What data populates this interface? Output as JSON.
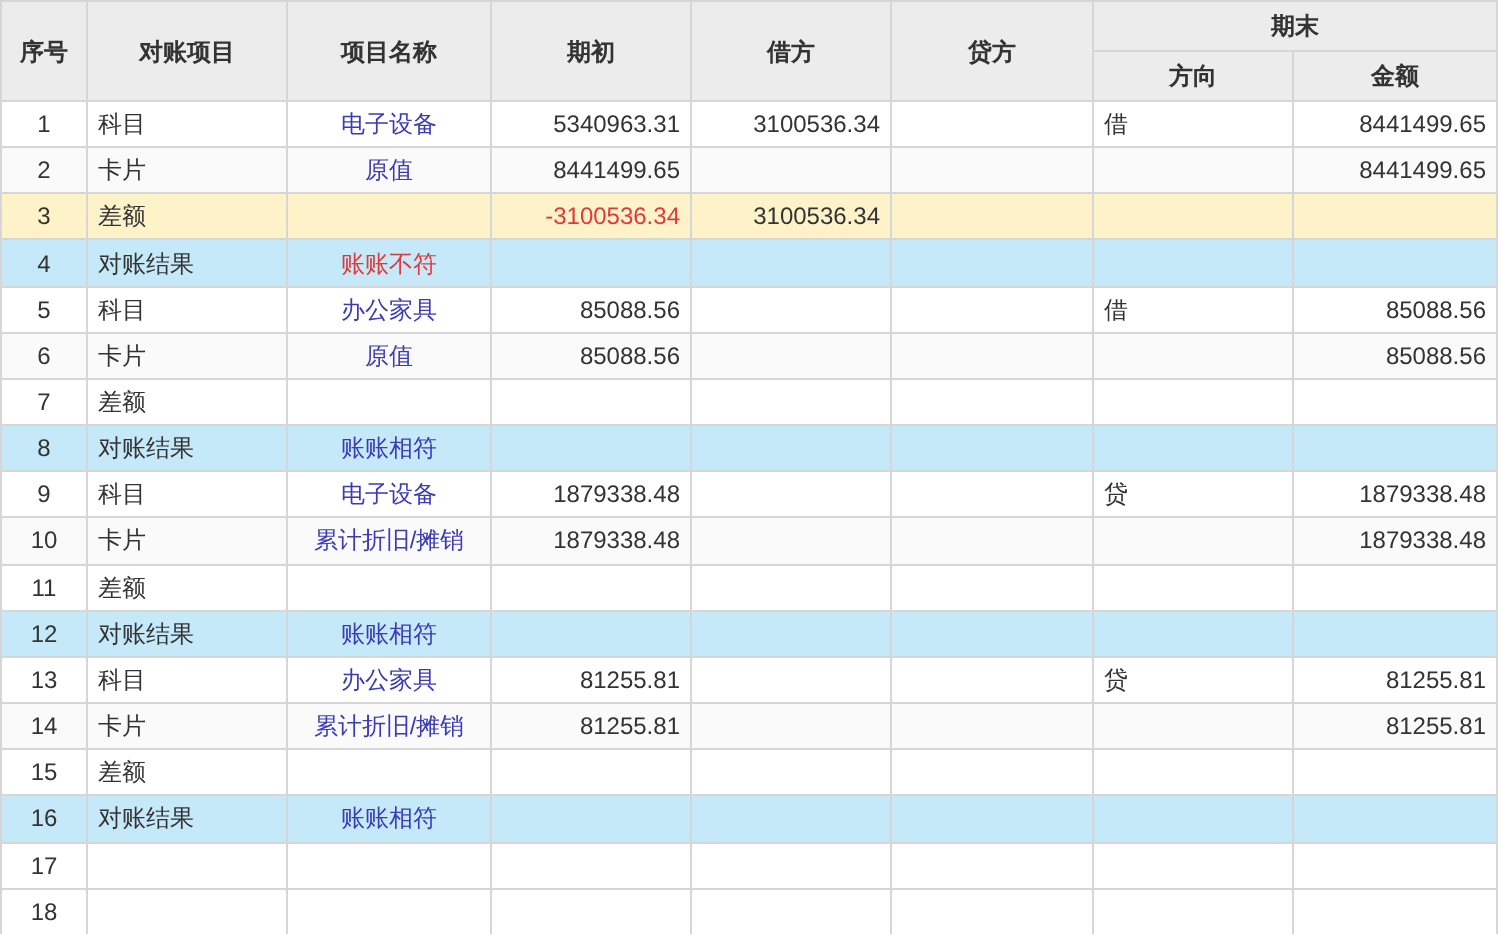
{
  "table": {
    "columns": [
      {
        "label": "序号"
      },
      {
        "label": "对账项目"
      },
      {
        "label": "项目名称"
      },
      {
        "label": "期初"
      },
      {
        "label": "借方"
      },
      {
        "label": "贷方"
      },
      {
        "label": "期末",
        "children": [
          {
            "label": "方向"
          },
          {
            "label": "金额"
          }
        ]
      }
    ],
    "rows": [
      {
        "no": "1",
        "kind": "subject",
        "item": "科目",
        "name": "电子设备",
        "opening": "5340963.31",
        "debit": "3100536.34",
        "direction": "借",
        "amount": "8441499.65"
      },
      {
        "no": "2",
        "kind": "card",
        "item": "卡片",
        "name": "原值",
        "opening": "8441499.65",
        "amount": "8441499.65"
      },
      {
        "no": "3",
        "kind": "diff",
        "flagged": true,
        "item": "差额",
        "opening": "-3100536.34",
        "debit": "3100536.34"
      },
      {
        "no": "4",
        "kind": "result",
        "flagged": true,
        "item": "对账结果",
        "name": "账账不符"
      },
      {
        "no": "5",
        "kind": "subject",
        "item": "科目",
        "name": "办公家具",
        "opening": "85088.56",
        "direction": "借",
        "amount": "85088.56"
      },
      {
        "no": "6",
        "kind": "card",
        "item": "卡片",
        "name": "原值",
        "opening": "85088.56",
        "amount": "85088.56"
      },
      {
        "no": "7",
        "kind": "diff",
        "flagged": false,
        "item": "差额"
      },
      {
        "no": "8",
        "kind": "result",
        "flagged": false,
        "item": "对账结果",
        "name": "账账相符"
      },
      {
        "no": "9",
        "kind": "subject",
        "item": "科目",
        "name": "电子设备",
        "opening": "1879338.48",
        "direction": "贷",
        "amount": "1879338.48"
      },
      {
        "no": "10",
        "kind": "card",
        "item": "卡片",
        "name": "累计折旧/摊销",
        "opening": "1879338.48",
        "amount": "1879338.48"
      },
      {
        "no": "11",
        "kind": "diff",
        "flagged": false,
        "item": "差额"
      },
      {
        "no": "12",
        "kind": "result",
        "flagged": false,
        "item": "对账结果",
        "name": "账账相符"
      },
      {
        "no": "13",
        "kind": "subject",
        "item": "科目",
        "name": "办公家具",
        "opening": "81255.81",
        "direction": "贷",
        "amount": "81255.81"
      },
      {
        "no": "14",
        "kind": "card",
        "item": "卡片",
        "name": "累计折旧/摊销",
        "opening": "81255.81",
        "amount": "81255.81"
      },
      {
        "no": "15",
        "kind": "diff",
        "flagged": false,
        "item": "差额"
      },
      {
        "no": "16",
        "kind": "result",
        "flagged": false,
        "item": "对账结果",
        "name": "账账相符"
      },
      {
        "no": "17",
        "kind": "empty"
      },
      {
        "no": "18",
        "kind": "empty"
      }
    ]
  }
}
